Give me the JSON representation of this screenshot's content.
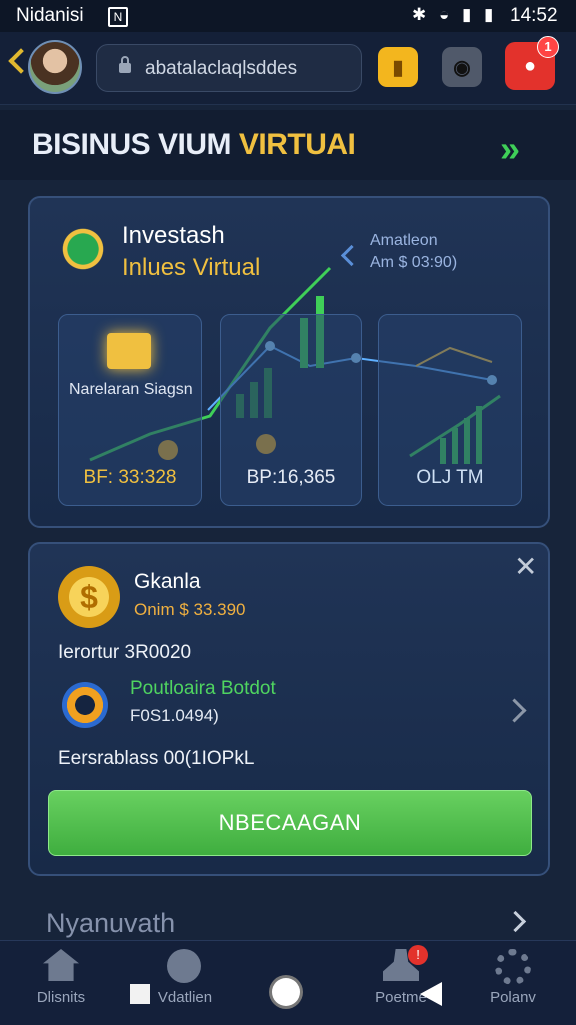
{
  "status_bar": {
    "carrier": "Nidanisi",
    "sim": "N",
    "icons": "✱ ◒ ▮ ▮",
    "time": "14:52"
  },
  "header": {
    "address": "abatalaclaqlsddes",
    "notification_count": "1"
  },
  "title": {
    "main": "BISINUS VIUM",
    "accent": "VIRTUAI"
  },
  "investment": {
    "name": "Investash",
    "subtitle": "Inlues Virtual",
    "amount_label": "Amatleon",
    "amount_value": "Am $ 03:90)",
    "tiles": [
      {
        "label": "Narelaran Siagsn",
        "value": "BF: 33:328"
      },
      {
        "value": "BP:16,365"
      },
      {
        "value": "OLJ TM"
      }
    ],
    "colors": {
      "accent": "#f0c040",
      "line_green": "#3fcf58",
      "line_blue": "#5fb0ff"
    }
  },
  "account": {
    "coin_symbol": "$",
    "name": "Gkanla",
    "sub": "Onim $ 33.390",
    "row1": "Ierortur 3R0020",
    "portfolio_title": "Poutloaira Botdot",
    "portfolio_value": "F0S1.0494)",
    "row3": "Eersrablass 00(1IOPkL",
    "cta": "NBECAAGAN"
  },
  "section": {
    "title": "Nyanuvath"
  },
  "nav": [
    {
      "label": "Dlisnits",
      "icon": "home-icon"
    },
    {
      "label": "Vdatlien",
      "icon": "clock-icon"
    },
    {
      "label": "Poetme",
      "icon": "person-icon",
      "badge": "!"
    },
    {
      "label": "Polanv",
      "icon": "settings-icon"
    }
  ]
}
